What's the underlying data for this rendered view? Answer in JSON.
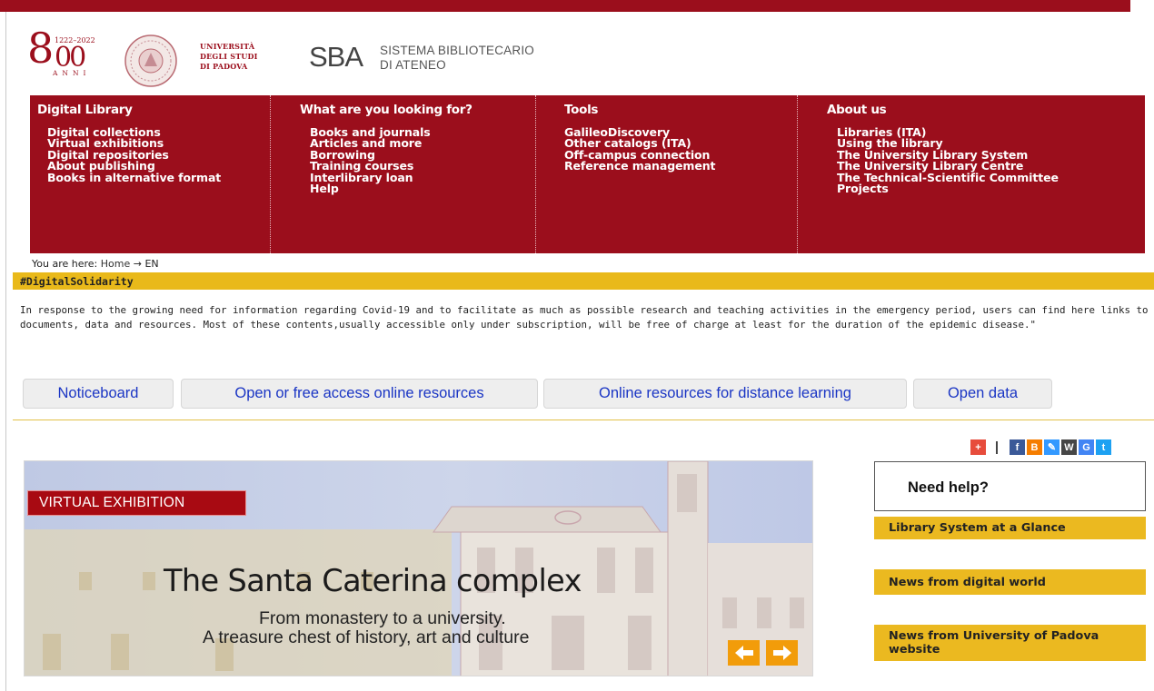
{
  "header": {
    "anniversary_logo": {
      "main": "8",
      "years": "1222–2022",
      "oo": "00",
      "word": "ANNI"
    },
    "university_name": [
      "UNIVERSITÀ",
      "DEGLI STUDI",
      "DI PADOVA"
    ],
    "sba_logo_text": "SBA",
    "sba_name": [
      "SISTEMA BIBLIOTECARIO",
      "DI ATENEO"
    ]
  },
  "menu": {
    "columns": [
      {
        "title": "Digital Library",
        "items": [
          "Digital collections",
          "Virtual exhibitions",
          "Digital repositories",
          "About publishing",
          "Books in alternative format"
        ]
      },
      {
        "title": "What are you looking for?",
        "items": [
          "Books and journals",
          "Articles and more",
          "Borrowing",
          "Training courses",
          "Interlibrary loan",
          "Help"
        ]
      },
      {
        "title": "Tools",
        "items": [
          "GalileoDiscovery",
          "Other catalogs (ITA)",
          "Off-campus connection",
          "Reference management"
        ]
      },
      {
        "title": "About us",
        "items": [
          "Libraries (ITA)",
          "Using the library",
          "The University Library System",
          "The University Library Centre",
          "The Technical-Scientific Committee",
          "Projects"
        ]
      }
    ]
  },
  "breadcrumb": {
    "prefix": "You are here:",
    "home": "Home",
    "arrow": "→",
    "current": "EN"
  },
  "solidarity": {
    "label": "#DigitalSolidarity"
  },
  "intro_text": "In response to the growing need for information regarding Covid-19 and to facilitate as much as possible research and teaching activities in the emergency period, users can find here links to documents, data and resources. Most of these contents,usually accessible only under subscription, will be free of charge at least for the duration of the epidemic disease.\"",
  "tabs": [
    "Noticeboard",
    "Open or free access online resources",
    "Online resources for distance learning",
    "Open data"
  ],
  "share": {
    "icons": [
      "plus-icon",
      "facebook-icon",
      "blogger-icon",
      "delicious-icon",
      "wordpress-icon",
      "google-icon",
      "twitter-icon"
    ],
    "letters": [
      "+",
      "f",
      "B",
      "✎",
      "W",
      "G",
      "t"
    ],
    "colors": [
      "#e74c3c",
      "#3b5998",
      "#f57d00",
      "#3399ff",
      "#464646",
      "#4285f4",
      "#1da1f2"
    ]
  },
  "hero": {
    "badge": "VIRTUAL EXHIBITION",
    "title": "The Santa Caterina complex",
    "subtitle_1": "From monastery to a university.",
    "subtitle_2": "A treasure chest of history, art and culture"
  },
  "sidebar": {
    "help": "Need help?",
    "buttons": [
      "Library System at a Glance",
      "News from digital world",
      "News from University of Padova website"
    ]
  },
  "colors": {
    "brand_red": "#9b0e1c",
    "accent_yellow": "#ebb920",
    "link_blue": "#1a35c4",
    "arrow_orange": "#f29c0a"
  }
}
